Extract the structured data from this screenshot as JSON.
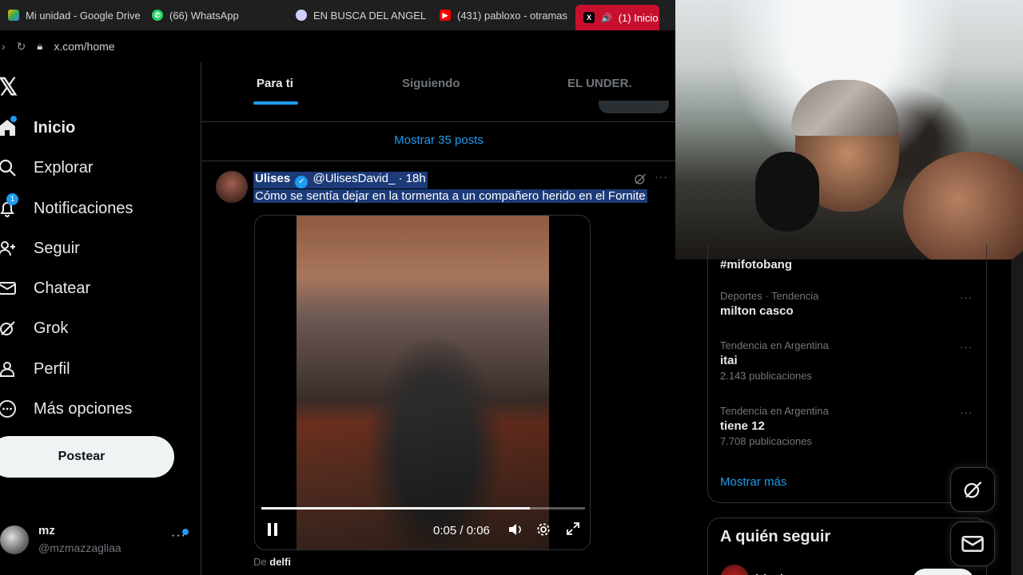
{
  "browser": {
    "tabs": [
      {
        "label": "Mi unidad - Google Drive",
        "icon": "google-drive-icon",
        "color": "#fbbc04"
      },
      {
        "label": "(66) WhatsApp",
        "icon": "whatsapp-icon",
        "color": "#25d366"
      },
      {
        "label": "EN BUSCA DEL ANGEL",
        "icon": "disc-icon",
        "color": "#d0d0ff"
      },
      {
        "label": "(431) pabloxo - otramas",
        "icon": "youtube-icon",
        "color": "#ff0000"
      },
      {
        "label": "(1) Inicio / X",
        "icon": "x-icon",
        "color": "#000000",
        "active": true
      }
    ],
    "url": "x.com/home"
  },
  "nav": {
    "items": [
      {
        "label": "Inicio",
        "icon": "home-icon"
      },
      {
        "label": "Explorar",
        "icon": "search-icon"
      },
      {
        "label": "Notificaciones",
        "icon": "bell-icon",
        "badge": "1"
      },
      {
        "label": "Seguir",
        "icon": "follow-icon"
      },
      {
        "label": "Chatear",
        "icon": "mail-icon"
      },
      {
        "label": "Grok",
        "icon": "grok-icon"
      },
      {
        "label": "Perfil",
        "icon": "profile-icon"
      },
      {
        "label": "Más opciones",
        "icon": "more-circle-icon"
      }
    ],
    "post_button": "Postear",
    "account": {
      "name": "mz",
      "handle": "@mzmazzagliaa"
    }
  },
  "feed": {
    "tabs": [
      "Para ti",
      "Siguiendo",
      "EL UNDER."
    ],
    "show_posts": "Mostrar 35 posts",
    "post": {
      "author": "Ulises",
      "handle": "@UlisesDavid_",
      "time": "· 18h",
      "text": "Cómo se sentía dejar en la tormenta a un compañero herido en el Fornite",
      "video_time": "0:05 / 0:06",
      "progress": 0.83,
      "source_prefix": "De",
      "source": "delfi"
    }
  },
  "trends": {
    "top_tag": "#mifotobang",
    "items": [
      {
        "meta": "Deportes · Tendencia",
        "name": "milton casco",
        "count": ""
      },
      {
        "meta": "Tendencia en Argentina",
        "name": "itai",
        "count": "2.143 publicaciones"
      },
      {
        "meta": "Tendencia en Argentina",
        "name": "tiene 12",
        "count": "7.708 publicaciones"
      }
    ],
    "show_more": "Mostrar más"
  },
  "who_to_follow": {
    "title": "A quién seguir",
    "user": "irissita"
  },
  "colors": {
    "accent": "#1d9bf0",
    "background": "#000000",
    "active_tab": "#c8102e",
    "selection": "#1c3b78"
  }
}
